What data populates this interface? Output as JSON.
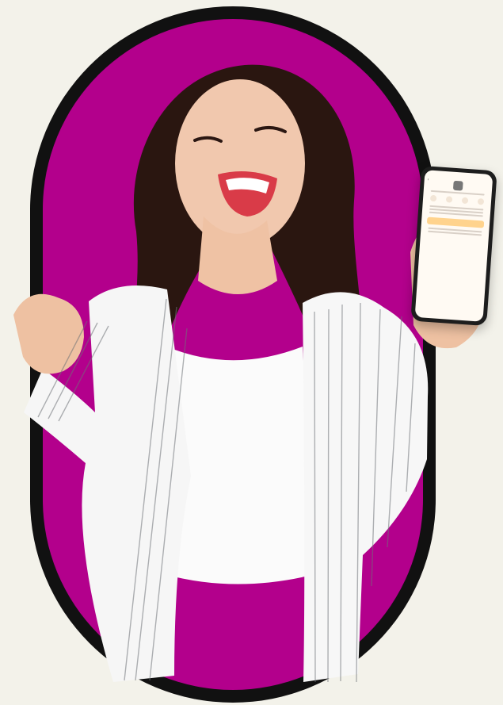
{
  "scene": {
    "description_hidden": "",
    "colors": {
      "background": "#f3f2ea",
      "frame": "#111111",
      "accent": "#b3008c",
      "phone_accent": "#ffd38d"
    }
  },
  "phone_ui": {
    "title": "",
    "name": "",
    "about_heading": "",
    "section_heading": ""
  }
}
